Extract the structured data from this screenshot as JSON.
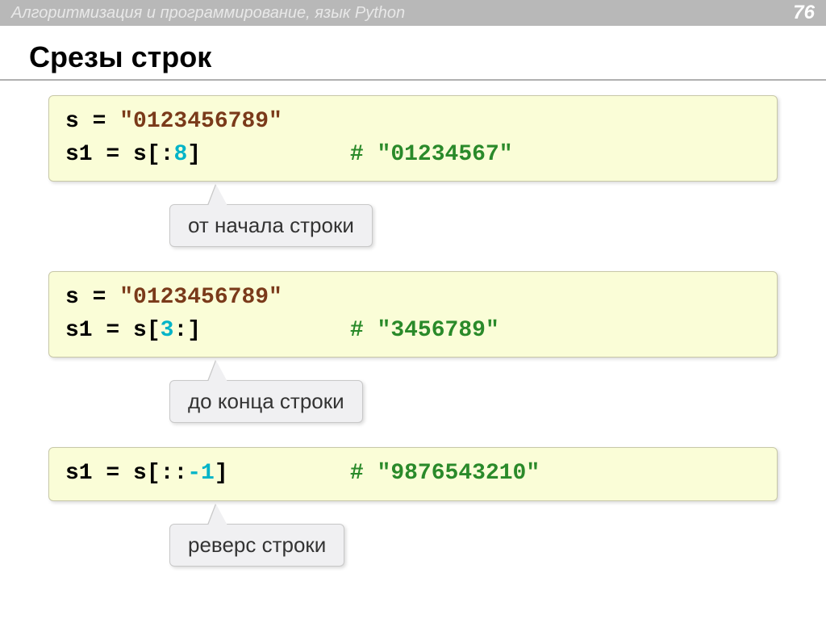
{
  "header": {
    "title": "Алгоритмизация и программирование, язык Python",
    "page_number": "76"
  },
  "main_title": "Срезы строк",
  "blocks": [
    {
      "code": {
        "line1_prefix": "s = ",
        "line1_string": "\"0123456789\"",
        "line2_prefix": "s1 = s[",
        "line2_slice_a": ":",
        "line2_slice_b": "8",
        "line2_suffix": "]",
        "line2_spacer": "           ",
        "line2_hash": "# ",
        "line2_comment": "\"01234567\""
      },
      "callout": "от начала строки"
    },
    {
      "code": {
        "line1_prefix": "s = ",
        "line1_string": "\"0123456789\"",
        "line2_prefix": "s1 = s[",
        "line2_slice_a": "3",
        "line2_slice_b": ":",
        "line2_suffix": "]",
        "line2_spacer": "           ",
        "line2_hash": "# ",
        "line2_comment": "\"3456789\""
      },
      "callout": "до конца строки"
    },
    {
      "code": {
        "line2_prefix": "s1 = s[",
        "line2_slice_a": ":",
        "line2_slice_colon2": ":",
        "line2_slice_b": "-1",
        "line2_suffix": "]",
        "line2_spacer": "         ",
        "line2_hash": "# ",
        "line2_comment": "\"9876543210\""
      },
      "callout": "реверс строки"
    }
  ]
}
